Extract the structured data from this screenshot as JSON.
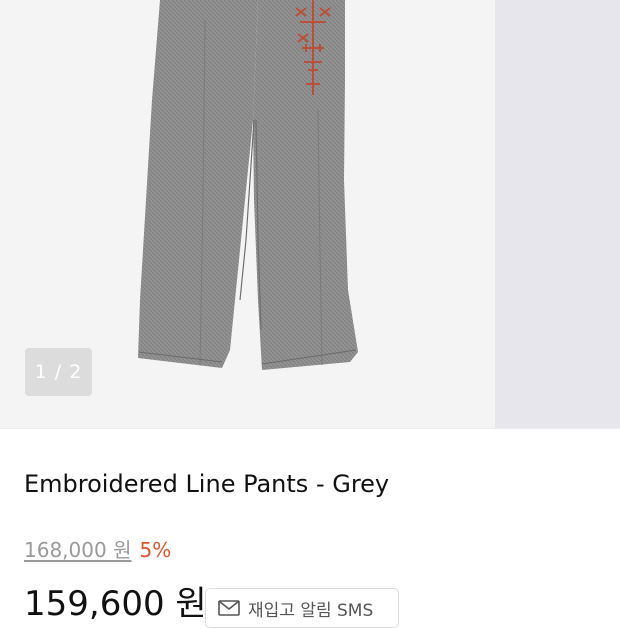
{
  "gallery": {
    "counter": "1 / 2",
    "image_alt": "Embroidered Line Pants - Grey product photo"
  },
  "product": {
    "title": "Embroidered Line Pants - Grey",
    "original_price": "168,000 원",
    "discount_rate": "5%",
    "sale_price": "159,600 원"
  },
  "actions": {
    "restock_label": "재입고 알림 SMS",
    "restock_icon": "mail-icon"
  },
  "colors": {
    "discount": "#e0532b",
    "pants": "#8f8f8f",
    "embroidery": "#b8503a"
  }
}
